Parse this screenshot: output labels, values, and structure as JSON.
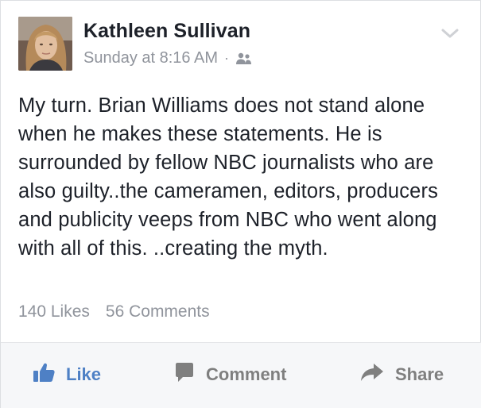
{
  "post": {
    "author": "Kathleen Sullivan",
    "timestamp": "Sunday at 8:16 AM",
    "separator": "·",
    "audience_icon": "friends-icon",
    "body": "My turn. Brian Williams does not stand alone when he makes these statements. He is surrounded by fellow NBC journalists who are also guilty..the cameramen, editors, producers and publicity veeps from NBC who went along with all of this. ..creating the myth."
  },
  "stats": {
    "likes": "140 Likes",
    "comments": "56 Comments"
  },
  "actions": {
    "like": "Like",
    "comment": "Comment",
    "share": "Share"
  },
  "colors": {
    "text": "#1d2129",
    "meta": "#90949c",
    "like_blue": "#4e80c5",
    "action_gray": "#7f7f7f",
    "action_bar_bg": "#f6f7f9"
  }
}
